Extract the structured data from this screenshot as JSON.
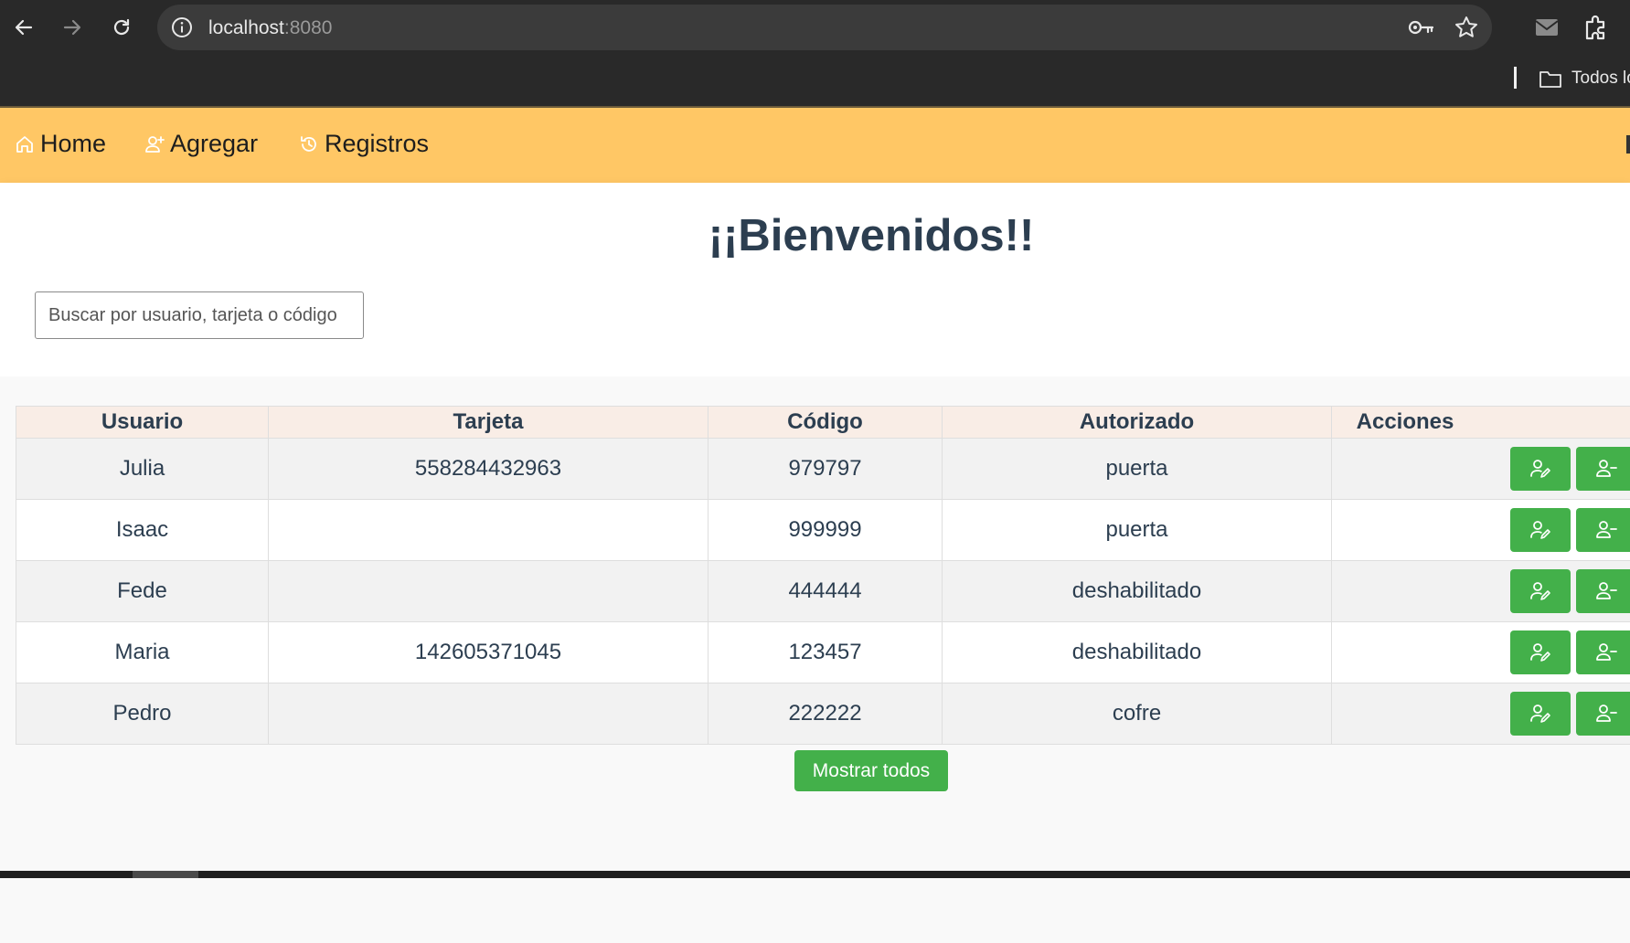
{
  "browser": {
    "url_host": "localhost",
    "url_port": ":8080",
    "bookmark_label": "Todos lo"
  },
  "navbar": {
    "items": [
      {
        "label": "Home",
        "icon": "home-icon"
      },
      {
        "label": "Agregar",
        "icon": "user-add-icon"
      },
      {
        "label": "Registros",
        "icon": "history-icon"
      }
    ]
  },
  "page": {
    "title": "¡¡Bienvenidos!!"
  },
  "search": {
    "placeholder": "Buscar por usuario, tarjeta o código",
    "value": ""
  },
  "table": {
    "headers": [
      "Usuario",
      "Tarjeta",
      "Código",
      "Autorizado",
      "Acciones"
    ],
    "rows": [
      {
        "usuario": "Julia",
        "tarjeta": "558284432963",
        "codigo": "979797",
        "autorizado": "puerta"
      },
      {
        "usuario": "Isaac",
        "tarjeta": "",
        "codigo": "999999",
        "autorizado": "puerta"
      },
      {
        "usuario": "Fede",
        "tarjeta": "",
        "codigo": "444444",
        "autorizado": "deshabilitado"
      },
      {
        "usuario": "Maria",
        "tarjeta": "142605371045",
        "codigo": "123457",
        "autorizado": "deshabilitado"
      },
      {
        "usuario": "Pedro",
        "tarjeta": "",
        "codigo": "222222",
        "autorizado": "cofre"
      }
    ],
    "action_icons": [
      "user-edit-icon",
      "user-remove-icon"
    ]
  },
  "buttons": {
    "show_all_label": "Mostrar todos"
  },
  "colors": {
    "navbar_bg": "#ffc765",
    "action_green": "#43b04a",
    "title_color": "#2c3e50",
    "header_bg": "#f9ede6"
  }
}
